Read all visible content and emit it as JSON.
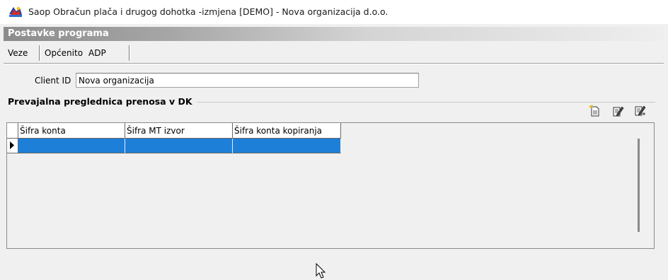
{
  "window": {
    "title": "Saop Obračun plača i drugog dohotka -izmjena  [DEMO] - Nova organizacija d.o.o.",
    "app_icon": "saop-app-icon"
  },
  "panel": {
    "title": "Postavke programa"
  },
  "tabs": [
    {
      "label": "Veze",
      "active": false
    },
    {
      "label": "Općenito",
      "active": false
    },
    {
      "label": "ADP",
      "active": true
    }
  ],
  "client": {
    "label": "Client ID",
    "value": "Nova organizacija"
  },
  "group": {
    "title": "Prevajalna preglednica prenosa v DK"
  },
  "toolbar": {
    "icons": [
      "new-record-icon",
      "edit-record-icon",
      "edit-all-icon"
    ]
  },
  "grid": {
    "columns": [
      "Šifra konta",
      "Šifra MT izvor",
      "Šifra konta kopiranja"
    ],
    "rows": [
      [
        "",
        "",
        ""
      ]
    ],
    "selected_row_color": "#1e7fd8"
  }
}
